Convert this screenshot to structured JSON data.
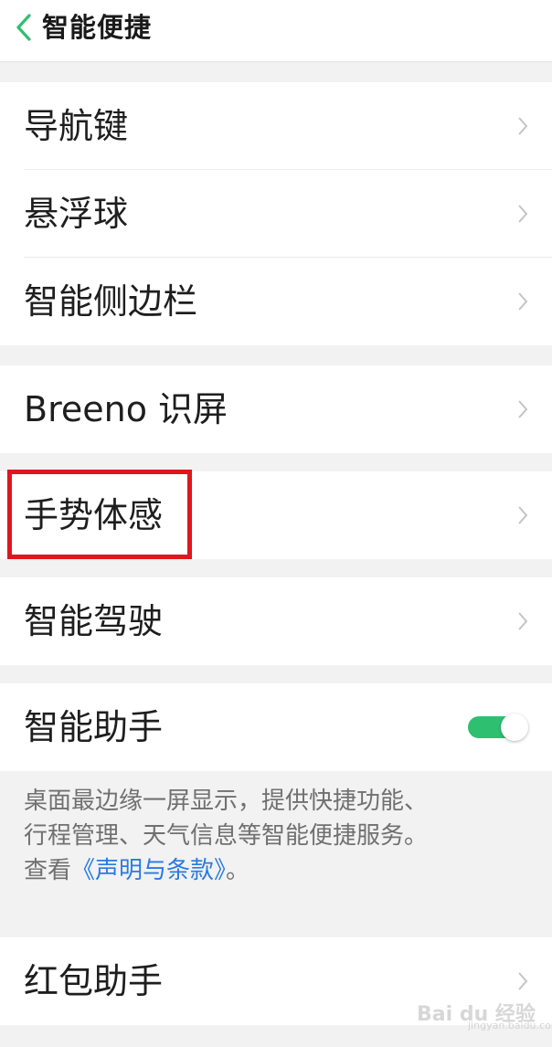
{
  "header": {
    "title": "智能便捷",
    "back_icon": "chevron-left-icon",
    "accent_color": "#2fbf71"
  },
  "groups": [
    {
      "items": [
        {
          "label": "导航键"
        },
        {
          "label": "悬浮球"
        },
        {
          "label": "智能侧边栏"
        }
      ]
    },
    {
      "items": [
        {
          "label": "Breeno 识屏"
        }
      ]
    },
    {
      "items": [
        {
          "label": "手势体感"
        }
      ]
    },
    {
      "items": [
        {
          "label": "智能驾驶"
        }
      ]
    },
    {
      "items": [
        {
          "label": "智能助手"
        }
      ]
    },
    {
      "items": [
        {
          "label": "红包助手"
        }
      ]
    }
  ],
  "assistant": {
    "toggle_on": true,
    "description_line1": "桌面最边缘一屏显示，提供快捷功能、",
    "description_line2": "行程管理、天气信息等智能便捷服务。",
    "description_prefix": "查看",
    "terms_link": "《声明与条款》",
    "description_suffix": "。"
  },
  "annotation": {
    "highlight_color": "#e0161d",
    "highlighted_item": "手势体感"
  },
  "watermark": {
    "text": "Bai du 经验",
    "sub": "jingyan.baidu.com"
  }
}
